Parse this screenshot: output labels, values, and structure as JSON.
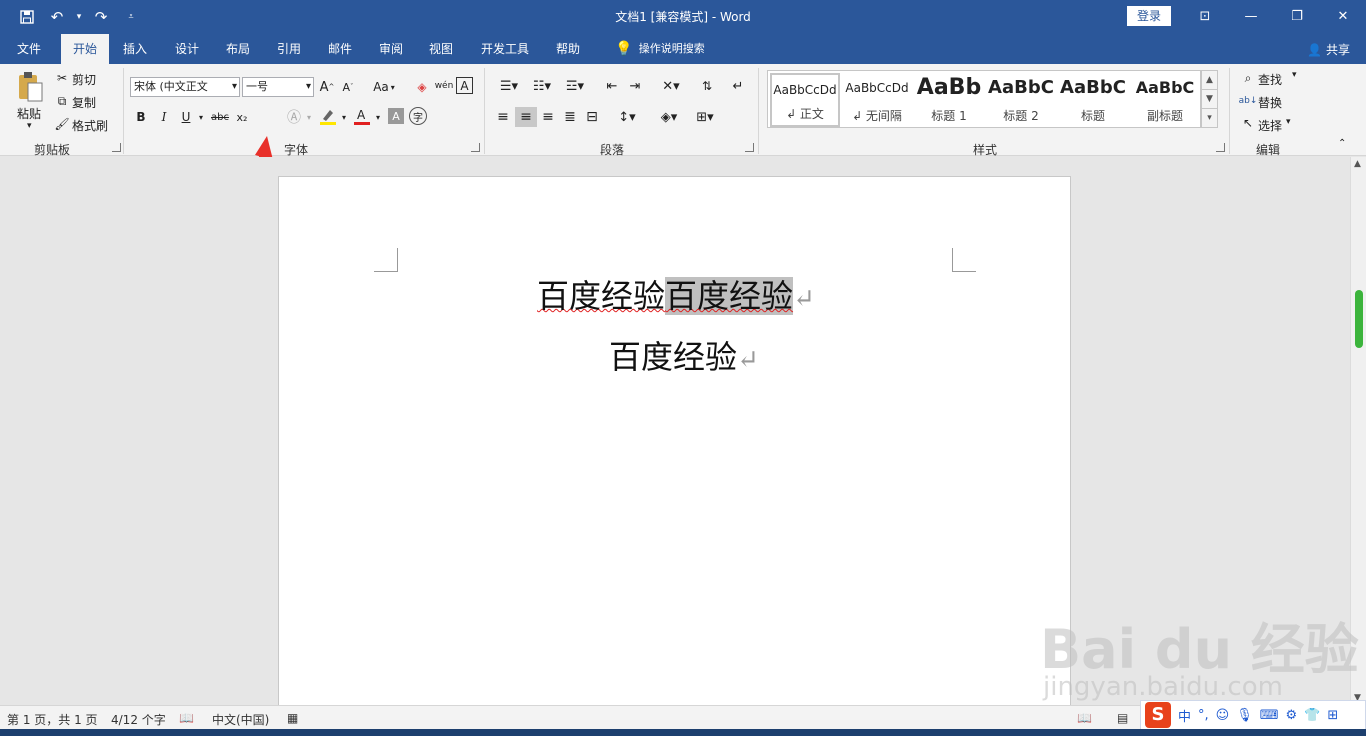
{
  "titlebar": {
    "title": "文档1 [兼容模式] - Word",
    "login": "登录"
  },
  "tabs": [
    "文件",
    "开始",
    "插入",
    "设计",
    "布局",
    "引用",
    "邮件",
    "审阅",
    "视图",
    "开发工具",
    "帮助"
  ],
  "tell_me": "操作说明搜索",
  "share": "共享",
  "clipboard": {
    "paste": "粘贴",
    "cut": "剪切",
    "copy": "复制",
    "format_painter": "格式刷",
    "group": "剪贴板"
  },
  "font": {
    "font_name": "宋体 (中文正文",
    "font_size": "一号",
    "group": "字体",
    "bold": "B",
    "italic": "I",
    "underline": "U",
    "strike": "abc",
    "subscript": "x₂",
    "superscript": "x²",
    "aa": "Aa",
    "wen": "wén",
    "a_border": "A",
    "zi": "字"
  },
  "paragraph": {
    "group": "段落"
  },
  "styles": {
    "group": "样式",
    "items": [
      {
        "preview": "AaBbCcDd",
        "name": "↲ 正文"
      },
      {
        "preview": "AaBbCcDd",
        "name": "↲ 无间隔"
      },
      {
        "preview": "AaBb",
        "name": "标题 1"
      },
      {
        "preview": "AaBbC",
        "name": "标题 2"
      },
      {
        "preview": "AaBbC",
        "name": "标题"
      },
      {
        "preview": "AaBbC",
        "name": "副标题"
      }
    ]
  },
  "editing": {
    "find": "查找",
    "replace": "替换",
    "select": "选择",
    "group": "编辑"
  },
  "document": {
    "line1_plain": "百度经验",
    "line1_selected": "百度经验",
    "line2": "百度经验",
    "para_mark": "↵"
  },
  "status": {
    "page": "第 1 页，共 1 页",
    "words": "4/12 个字",
    "language": "中文(中国)"
  },
  "ime": {
    "logo": "S",
    "mode": "中"
  },
  "watermark": {
    "brand": "Bai du 经验",
    "url": "jingyan.baidu.com"
  }
}
